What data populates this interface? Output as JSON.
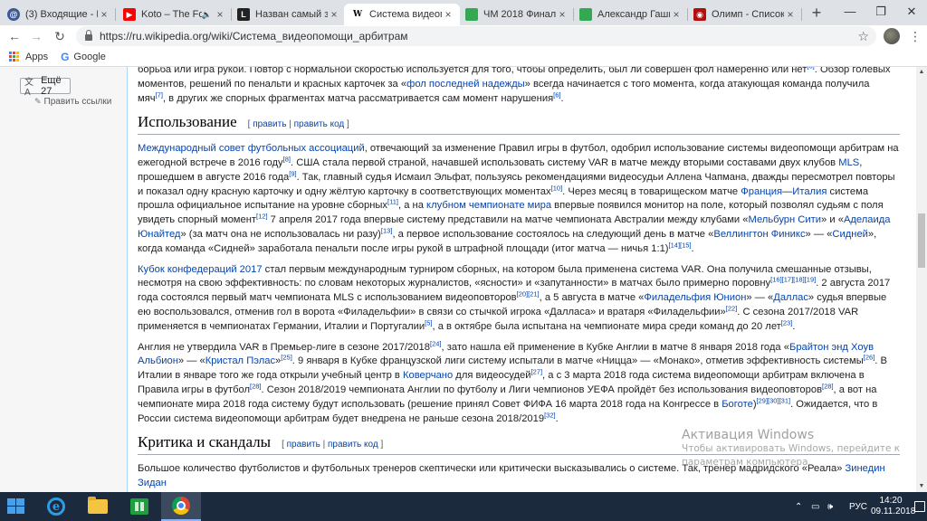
{
  "browser": {
    "tabs": [
      {
        "title": "(3) Входящие - По",
        "icon": "mail-icon",
        "color": "#3b5998",
        "active": false
      },
      {
        "title": "Koto – The For",
        "icon": "youtube-icon",
        "color": "#ff0000",
        "active": false,
        "muted": true
      },
      {
        "title": "Назван самый зап",
        "icon": "letter-l-icon",
        "color": "#222222",
        "active": false
      },
      {
        "title": "Система видеопом",
        "icon": "wikipedia-icon",
        "color": "#ffffff",
        "active": true
      },
      {
        "title": "ЧМ 2018 Финал - ",
        "icon": "sheets-icon",
        "color": "#34a853",
        "active": false
      },
      {
        "title": "Александр Гашин",
        "icon": "sheets-icon",
        "color": "#34a853",
        "active": false
      },
      {
        "title": "Олимп - Список с",
        "icon": "olimp-icon",
        "color": "#b01010",
        "active": false
      }
    ],
    "url": "https://ru.wikipedia.org/wiki/Система_видеопомощи_арбитрам",
    "bookmarks": [
      {
        "label": "Apps",
        "icon": "apps-grid-icon"
      },
      {
        "label": "Google",
        "icon": "google-g-icon"
      }
    ]
  },
  "sidebar": {
    "languages_label": "Ещё 27",
    "edit_links_label": "Править ссылки"
  },
  "article": {
    "intro_paragraph": [
      {
        "t": "борьба или игра рукой. Повтор с нормальной скоростью используется для того, чтобы определить, был ли совершен фол намеренно или нет"
      },
      {
        "sup": "[6]"
      },
      {
        "t": ". Обзор голевых моментов, решений по пенальти и красных карточек за «"
      },
      {
        "a": "фол последней надежды"
      },
      {
        "t": "» всегда начинается с того момента, когда атакующая команда получила мяч"
      },
      {
        "sup": "[7]"
      },
      {
        "t": ", в других же спорных фрагментах матча рассматривается сам момент нарушения"
      },
      {
        "sup": "[6]"
      },
      {
        "t": "."
      }
    ],
    "section1": {
      "title": "Использование",
      "edit": "править",
      "edit_code": "править код"
    },
    "p1": [
      {
        "a": "Международный совет футбольных ассоциаций"
      },
      {
        "t": ", отвечающий за изменение Правил игры в футбол, одобрил использование системы видеопомощи арбитрам на ежегодной встрече в 2016 году"
      },
      {
        "sup": "[8]"
      },
      {
        "t": ". США стала первой страной, начавшей использовать систему VAR в матче между вторыми составами двух клубов "
      },
      {
        "a": "MLS"
      },
      {
        "t": ", прошедшем в августе 2016 года"
      },
      {
        "sup": "[9]"
      },
      {
        "t": ". Так, главный судья Исмаил Эльфат, пользуясь рекомендациями видеосудьи Аллена Чапмана, дважды пересмотрел повторы и показал одну красную карточку и одну жёлтую карточку в соответствующих моментах"
      },
      {
        "sup": "[10]"
      },
      {
        "t": ". Через месяц в товарищеском матче "
      },
      {
        "a": "Франция"
      },
      {
        "t": "—"
      },
      {
        "a": "Италия"
      },
      {
        "t": " система прошла официальное испытание на уровне сборных"
      },
      {
        "sup": "[11]"
      },
      {
        "t": ", а на "
      },
      {
        "a": "клубном чемпионате мира"
      },
      {
        "t": " впервые появился монитор на поле, который позволял судьям с поля увидеть спорный момент"
      },
      {
        "sup": "[12]"
      },
      {
        "t": " 7 апреля 2017 года впервые систему представили на матче чемпионата Австралии между клубами «"
      },
      {
        "a": "Мельбурн Сити"
      },
      {
        "t": "» и «"
      },
      {
        "a": "Аделаида Юнайтед"
      },
      {
        "t": "» (за матч она не использовалась ни разу)"
      },
      {
        "sup": "[13]"
      },
      {
        "t": ", а первое использование состоялось на следующий день в матче «"
      },
      {
        "a": "Веллингтон Финикс"
      },
      {
        "t": "» — «"
      },
      {
        "a": "Сидней"
      },
      {
        "t": "», когда команда «Сидней» заработала пенальти после игры рукой в штрафной площади (итог матча — ничья 1:1)"
      },
      {
        "sup": "[14][15]"
      },
      {
        "t": "."
      }
    ],
    "p2": [
      {
        "a": "Кубок конфедераций 2017"
      },
      {
        "t": " стал первым международным турниром сборных, на котором была применена система VAR. Она получила смешанные отзывы, несмотря на свою эффективность: по словам некоторых журналистов, «ясности» и «запутанности» в матчах было примерно поровну"
      },
      {
        "sup": "[16][17][18][19]"
      },
      {
        "t": ". 2 августа 2017 года состоялся первый матч чемпионата MLS с использованием видеоповторов"
      },
      {
        "sup": "[20][21]"
      },
      {
        "t": ", а 5 августа в матче «"
      },
      {
        "a": "Филадельфия Юнион"
      },
      {
        "t": "» — «"
      },
      {
        "a": "Даллас"
      },
      {
        "t": "» судья впервые ею воспользовался, отменив гол в ворота «Филадельфии» в связи со стычкой игрока «Далласа» и вратаря «Филадельфии»"
      },
      {
        "sup": "[22]"
      },
      {
        "t": ". С сезона 2017/2018 VAR применяется в чемпионатах Германии, Италии и Португалии"
      },
      {
        "sup": "[5]"
      },
      {
        "t": ", а в октябре была испытана на чемпионате мира среди команд до 20 лет"
      },
      {
        "sup": "[23]"
      },
      {
        "t": "."
      }
    ],
    "p3": [
      {
        "t": "Англия не утвердила VAR в Премьер-лиге в сезоне 2017/2018"
      },
      {
        "sup": "[24]"
      },
      {
        "t": ", зато нашла ей применение в Кубке Англии в матче 8 января 2018 года «"
      },
      {
        "a": "Брайтон энд Хоув Альбион"
      },
      {
        "t": "» — «"
      },
      {
        "a": "Кристал Пэлас"
      },
      {
        "t": "»"
      },
      {
        "sup": "[25]"
      },
      {
        "t": ". 9 января в Кубке французской лиги систему испытали в матче «Ницца» — «Монако», отметив эффективность системы"
      },
      {
        "sup": "[26]"
      },
      {
        "t": ". В Италии в январе того же года открыли учебный центр в "
      },
      {
        "a": "Коверчано"
      },
      {
        "t": " для видеосудей"
      },
      {
        "sup": "[27]"
      },
      {
        "t": ", а с 3 марта 2018 года система видеопомощи арбитрам включена в Правила игры в футбол"
      },
      {
        "sup": "[28]"
      },
      {
        "t": ". Сезон 2018/2019 чемпионата Англии по футболу и Лиги чемпионов УЕФА пройдёт без использования видеоповторов"
      },
      {
        "sup": "[28]"
      },
      {
        "t": ", а вот на чемпионате мира 2018 года систему будут использовать (решение принял Совет ФИФА 16 марта 2018 года на Конгрессе в "
      },
      {
        "a": "Боготе"
      },
      {
        "t": ")"
      },
      {
        "sup": "[29][30][31]"
      },
      {
        "t": ". Ожидается, что в России система видеопомощи арбитрам будет внедрена не раньше сезона 2018/2019"
      },
      {
        "sup": "[32]"
      },
      {
        "t": "."
      }
    ],
    "section2": {
      "title": "Критика и скандалы",
      "edit": "править",
      "edit_code": "править код"
    },
    "p4": [
      {
        "t": "Большое количество футболистов и футбольных тренеров скептически или критически высказывались о системе. Так, тренер мадридского «Реала» "
      },
      {
        "a": "Зинедин Зидан"
      }
    ]
  },
  "watermark": {
    "title": "Активация Windows",
    "line1": "Чтобы активировать Windows, перейдите к",
    "line2": "параметрам компьютера."
  },
  "taskbar": {
    "apps": [
      "internet-explorer-icon",
      "file-explorer-icon",
      "store-icon",
      "chrome-icon"
    ],
    "language": "РУС",
    "time": "14:20",
    "date": "09.11.2018"
  }
}
